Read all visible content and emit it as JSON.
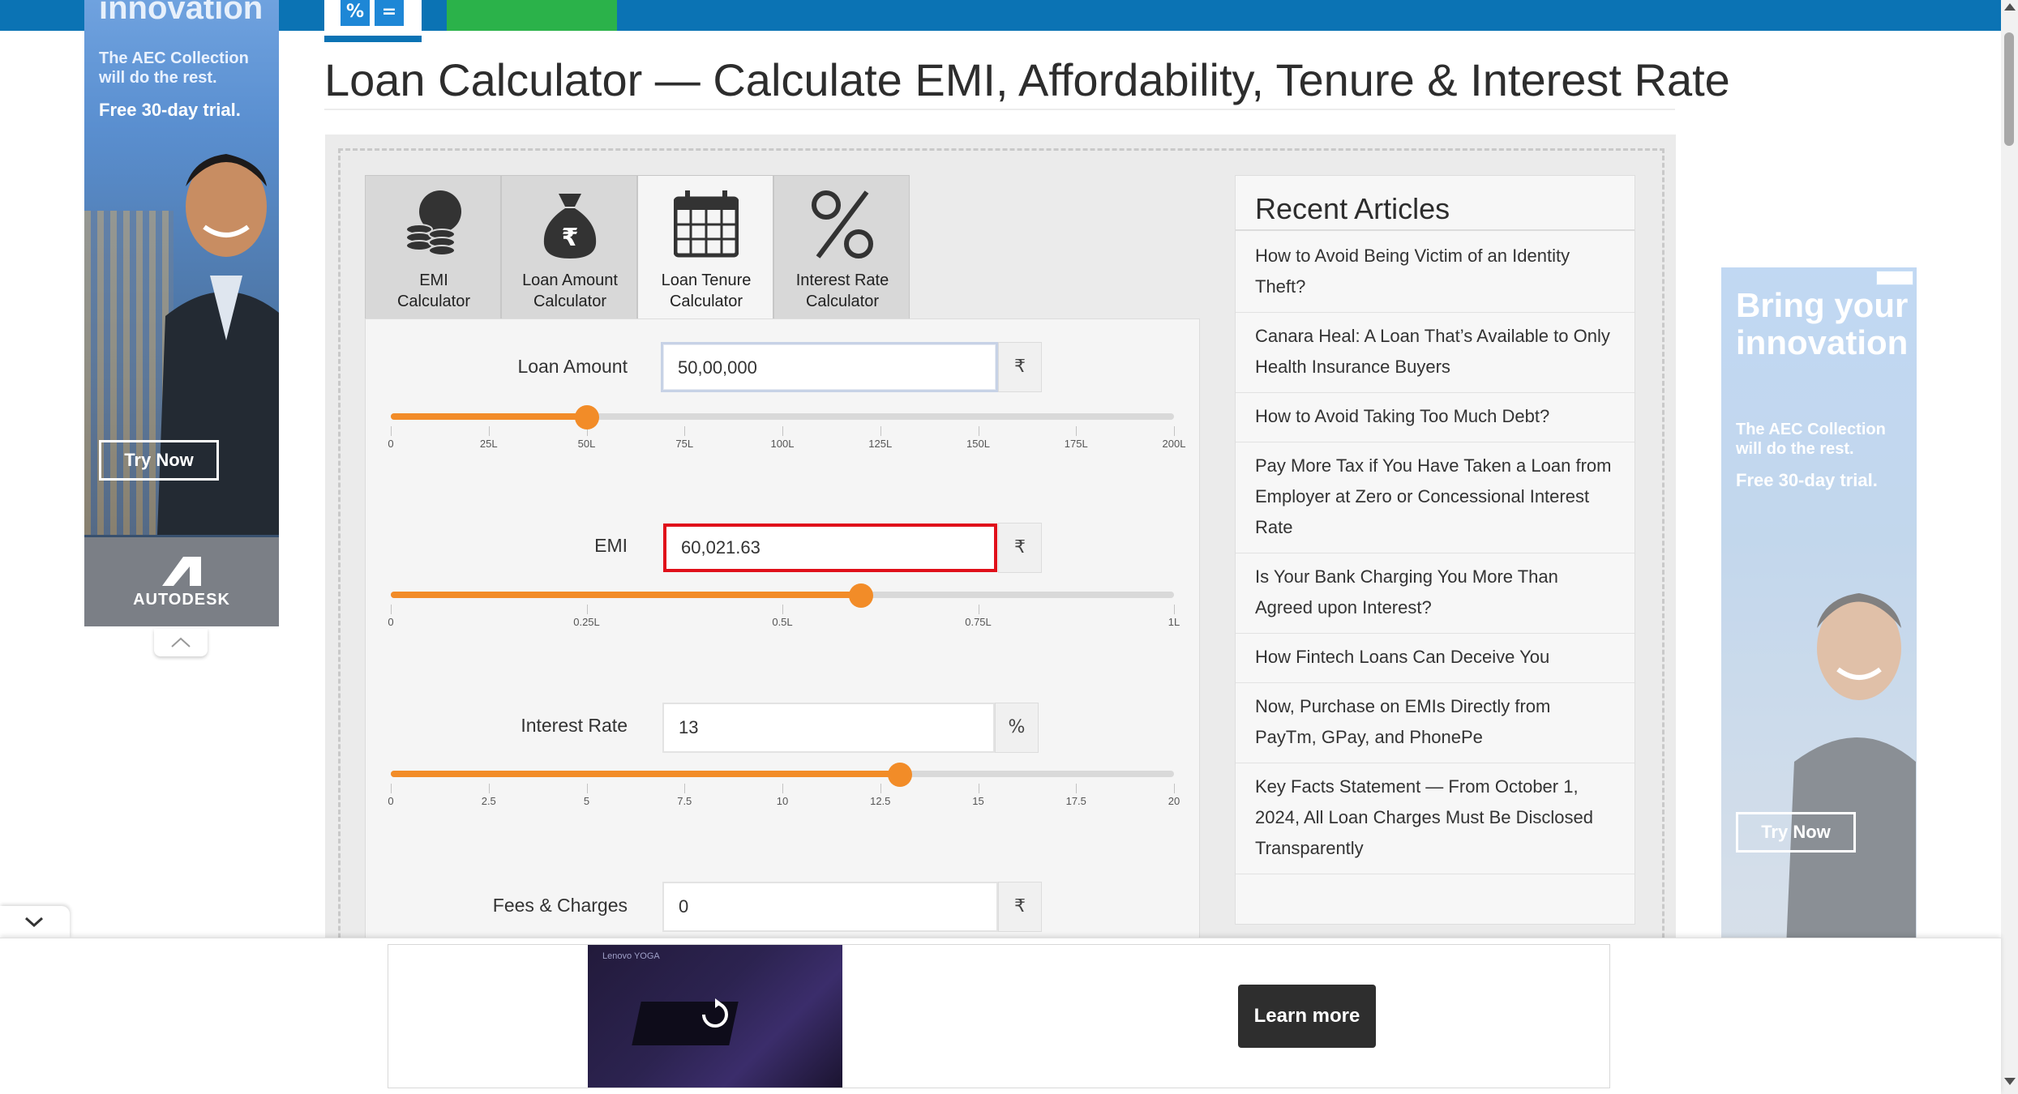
{
  "topbar": {
    "percent_tab": "%",
    "equals_tab": "="
  },
  "left_ad": {
    "headline": "innovation",
    "line1": "The AEC Collection will do the rest.",
    "line2": "Free 30-day trial.",
    "cta": "Try Now",
    "brand": "AUTODESK"
  },
  "page": {
    "title": "Loan Calculator — Calculate EMI, Affordability, Tenure & Interest Rate"
  },
  "tabs": [
    {
      "label": "EMI\nCalculator",
      "icon": "coins-icon",
      "active": false
    },
    {
      "label": "Loan Amount\nCalculator",
      "icon": "money-bag-icon",
      "active": false
    },
    {
      "label": "Loan Tenure\nCalculator",
      "icon": "calendar-icon",
      "active": true
    },
    {
      "label": "Interest Rate\nCalculator",
      "icon": "percent-icon",
      "active": false
    }
  ],
  "form": {
    "loan_amount": {
      "label": "Loan Amount",
      "value": "50,00,000",
      "unit": "₹",
      "slider_fraction": 0.25,
      "ticks": [
        "0",
        "25L",
        "50L",
        "75L",
        "100L",
        "125L",
        "150L",
        "175L",
        "200L"
      ]
    },
    "emi": {
      "label": "EMI",
      "value": "60,021.63",
      "unit": "₹",
      "slider_fraction": 0.6,
      "ticks": [
        "0",
        "0.25L",
        "0.5L",
        "0.75L",
        "1L"
      ]
    },
    "interest_rate": {
      "label": "Interest Rate",
      "value": "13",
      "unit": "%",
      "slider_fraction": 0.65,
      "ticks": [
        "0",
        "2.5",
        "5",
        "7.5",
        "10",
        "12.5",
        "15",
        "17.5",
        "20"
      ]
    },
    "fees": {
      "label": "Fees & Charges",
      "value": "0",
      "unit": "₹"
    }
  },
  "articles": {
    "heading": "Recent Articles",
    "items": [
      "How to Avoid Being Victim of an Identity Theft?",
      "Canara Heal: A Loan That’s Available to Only Health Insurance Buyers",
      "How to Avoid Taking Too Much Debt?",
      "Pay More Tax if You Have Taken a Loan from Employer at Zero or Concessional Interest Rate",
      "Is Your Bank Charging You More Than Agreed upon Interest?",
      "How Fintech Loans Can Deceive You",
      "Now, Purchase on EMIs Directly from PayTm, GPay, and PhonePe",
      "Key Facts Statement — From October 1, 2024, All Loan Charges Must Be Disclosed Transparently"
    ]
  },
  "right_ad": {
    "headline": "Bring your innovation",
    "line1": "The AEC Collection will do the rest.",
    "line2": "Free 30-day trial.",
    "cta": "Try Now"
  },
  "sticky_ad": {
    "video_brand": "Lenovo YOGA",
    "cta": "Learn more"
  },
  "colors": {
    "accent": "#f28c28",
    "topbar": "#0b73b4",
    "error_border": "#e0101a"
  }
}
